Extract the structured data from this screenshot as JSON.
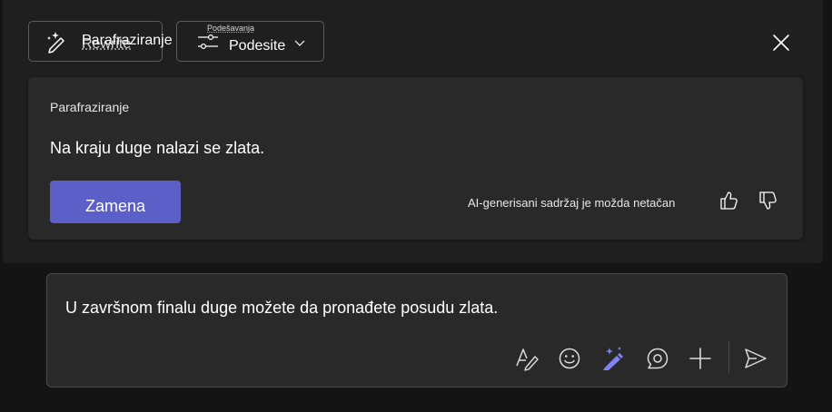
{
  "toolbar": {
    "rewrite_ghost_label": "Rewrite",
    "rewrite_label": "Parafraziranje",
    "settings_ghost_label": "Podešavanja",
    "settings_label": "Podesite"
  },
  "suggestion": {
    "title": "Parafraziranje",
    "text": "Na kraju duge nalazi se zlata.",
    "replace_label": "Zamena",
    "ai_disclaimer": "AI-generisani sadržaj je možda netačan"
  },
  "compose": {
    "message": "U završnom finalu duge možete da pronađete posudu zlata."
  },
  "colors": {
    "accent": "#5b5fc7",
    "copilot_icon": "#7f85f5",
    "background": "#141414",
    "panel": "#1f1f1f",
    "card": "#292929"
  },
  "icons": {
    "rewrite": "sparkle-pen-icon",
    "settings": "sliders-icon",
    "settings_chevron": "chevron-down-icon",
    "close": "close-icon",
    "thumbs_up": "thumbs-up-icon",
    "thumbs_down": "thumbs-down-icon",
    "format": "format-text-icon",
    "emoji": "emoji-icon",
    "copilot": "copilot-pen-icon",
    "loop": "loop-icon",
    "attach": "plus-icon",
    "send": "send-icon"
  }
}
